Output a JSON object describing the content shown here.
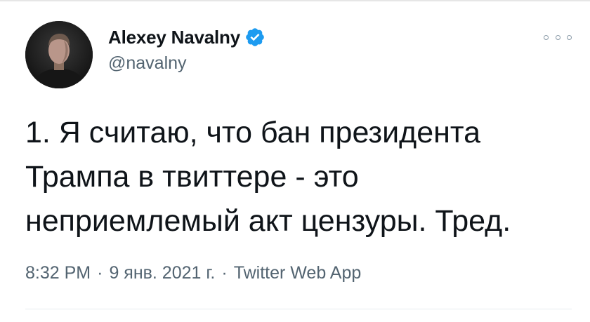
{
  "tweet": {
    "author": {
      "display_name": "Alexey Navalny",
      "handle": "@navalny",
      "verified": true,
      "avatar_icon": "user-avatar-photo",
      "verified_icon": "verified-badge-icon",
      "verified_color": "#1d9bf0"
    },
    "more_icon": "more-options-icon",
    "text": "1. Я считаю, что бан президента\nТрампа в твиттере - это\nнеприемлемый акт цензуры. Тред.",
    "time": "8:32 PM",
    "date": "9 янв. 2021 г.",
    "source": "Twitter Web App",
    "separator": "·"
  }
}
